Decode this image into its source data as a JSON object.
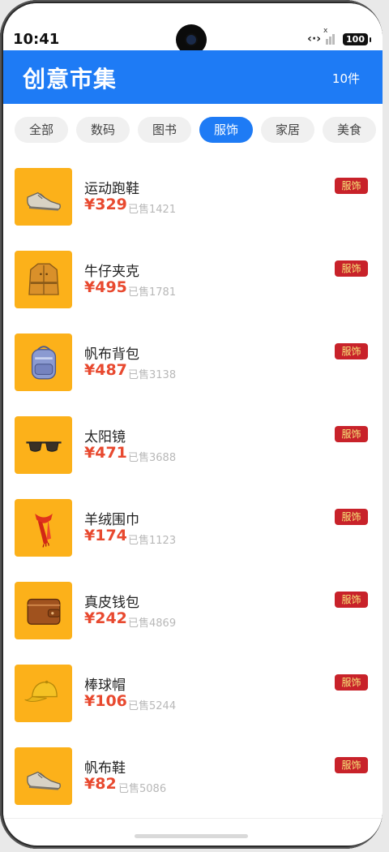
{
  "status": {
    "time": "10:41",
    "battery": "100"
  },
  "header": {
    "title": "创意市集",
    "count": "10件"
  },
  "tabs": [
    "全部",
    "数码",
    "图书",
    "服饰",
    "家居",
    "美食"
  ],
  "active_tab": "服饰",
  "products": [
    {
      "name": "运动跑鞋",
      "price": "¥329",
      "sold": "已售1421",
      "tag": "服饰",
      "icon": "sneaker-icon"
    },
    {
      "name": "牛仔夹克",
      "price": "¥495",
      "sold": "已售1781",
      "tag": "服饰",
      "icon": "coat-icon"
    },
    {
      "name": "帆布背包",
      "price": "¥487",
      "sold": "已售3138",
      "tag": "服饰",
      "icon": "backpack-icon"
    },
    {
      "name": "太阳镜",
      "price": "¥471",
      "sold": "已售3688",
      "tag": "服饰",
      "icon": "sunglasses-icon"
    },
    {
      "name": "羊绒围巾",
      "price": "¥174",
      "sold": "已售1123",
      "tag": "服饰",
      "icon": "scarf-icon"
    },
    {
      "name": "真皮钱包",
      "price": "¥242",
      "sold": "已售4869",
      "tag": "服饰",
      "icon": "wallet-icon"
    },
    {
      "name": "棒球帽",
      "price": "¥106",
      "sold": "已售5244",
      "tag": "服饰",
      "icon": "cap-icon"
    },
    {
      "name": "帆布鞋",
      "price": "¥82",
      "sold": "已售5086",
      "tag": "服饰",
      "icon": "sneaker-icon"
    }
  ],
  "colors": {
    "brand": "#1e7bf5",
    "price": "#e8492f",
    "badge_bg": "#c8222a",
    "badge_text": "#f7e67a",
    "thumb_bg": "#fcb11a"
  }
}
